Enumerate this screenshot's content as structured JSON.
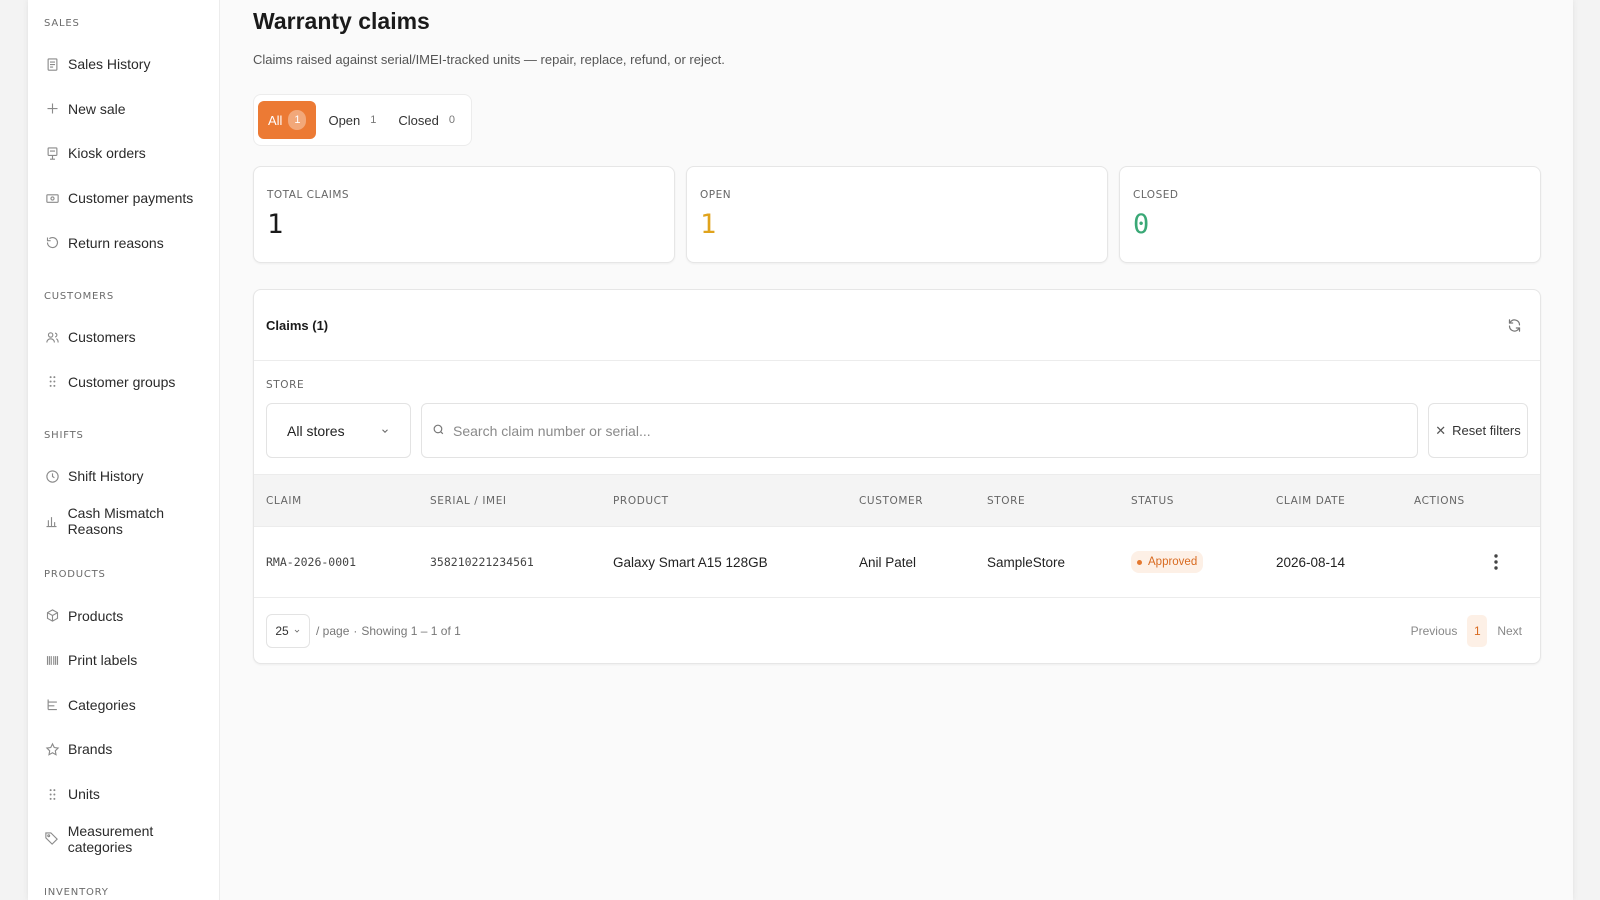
{
  "sidebar": {
    "sections": [
      {
        "title": "SALES",
        "items": [
          {
            "label": "Sales History",
            "icon": "receipt-icon"
          },
          {
            "label": "New sale",
            "icon": "plus-icon"
          },
          {
            "label": "Kiosk orders",
            "icon": "kiosk-icon"
          },
          {
            "label": "Customer payments",
            "icon": "payment-icon"
          },
          {
            "label": "Return reasons",
            "icon": "undo-icon"
          }
        ]
      },
      {
        "title": "CUSTOMERS",
        "items": [
          {
            "label": "Customers",
            "icon": "users-icon"
          },
          {
            "label": "Customer groups",
            "icon": "grip-icon"
          }
        ]
      },
      {
        "title": "SHIFTS",
        "items": [
          {
            "label": "Shift History",
            "icon": "clock-icon"
          },
          {
            "label": "Cash Mismatch Reasons",
            "icon": "bar-chart-icon"
          }
        ]
      },
      {
        "title": "PRODUCTS",
        "items": [
          {
            "label": "Products",
            "icon": "box-icon"
          },
          {
            "label": "Print labels",
            "icon": "barcode-icon"
          },
          {
            "label": "Categories",
            "icon": "hierarchy-icon"
          },
          {
            "label": "Brands",
            "icon": "star-icon"
          },
          {
            "label": "Units",
            "icon": "grip-icon"
          },
          {
            "label": "Measurement categories",
            "icon": "tag-icon"
          }
        ]
      },
      {
        "title": "INVENTORY",
        "items": []
      }
    ]
  },
  "page": {
    "title": "Warranty claims",
    "subtitle": "Claims raised against serial/IMEI-tracked units — repair, replace, refund, or reject."
  },
  "tabs": [
    {
      "label": "All",
      "count": "1",
      "active": true
    },
    {
      "label": "Open",
      "count": "1",
      "active": false
    },
    {
      "label": "Closed",
      "count": "0",
      "active": false
    }
  ],
  "stats": [
    {
      "label": "TOTAL CLAIMS",
      "value": "1",
      "color": "#1a1a1a"
    },
    {
      "label": "OPEN",
      "value": "1",
      "color": "#e0a31c"
    },
    {
      "label": "CLOSED",
      "value": "0",
      "color": "#3aa876"
    }
  ],
  "claims": {
    "title": "Claims (1)",
    "store_label": "STORE",
    "store_selected": "All stores",
    "search_placeholder": "Search claim number or serial...",
    "reset_label": "Reset filters",
    "columns": [
      "CLAIM",
      "SERIAL / IMEI",
      "PRODUCT",
      "CUSTOMER",
      "STORE",
      "STATUS",
      "CLAIM DATE",
      "ACTIONS"
    ],
    "rows": [
      {
        "claim": "RMA-2026-0001",
        "serial": "358210221234561",
        "product": "Galaxy Smart A15 128GB",
        "customer": "Anil Patel",
        "store": "SampleStore",
        "status": "Approved",
        "date": "2026-08-14"
      }
    ],
    "pager": {
      "per_page": "25",
      "per_page_label": "/ page",
      "sep": "·",
      "showing": "Showing 1 – 1 of 1",
      "previous": "Previous",
      "current": "1",
      "next": "Next"
    }
  },
  "colors": {
    "accent": "#ec7a34",
    "status_approved_bg": "#fdf0e6",
    "status_approved_text": "#d86a20"
  }
}
